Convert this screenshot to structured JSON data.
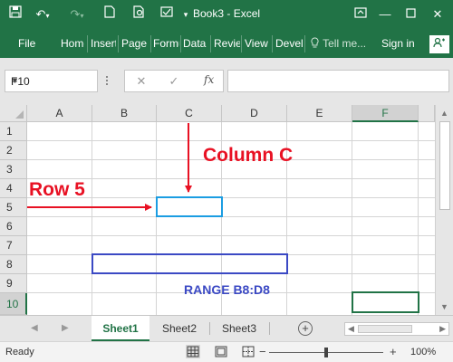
{
  "window": {
    "title": "Book3  -  Excel",
    "window_controls": [
      "restore-ribbon-icon",
      "minimize-icon",
      "maximize-icon",
      "close-icon"
    ]
  },
  "quick_access": [
    "save-icon",
    "undo-icon",
    "redo-icon",
    "new-file-icon",
    "print-preview-icon",
    "spelling-icon",
    "customize-qat-icon"
  ],
  "ribbon": {
    "tabs": [
      "File",
      "Home",
      "Insert",
      "Page Layout",
      "Formulas",
      "Data",
      "Review",
      "View",
      "Developer"
    ],
    "tell_me": "Tell me...",
    "sign_in": "Sign in",
    "share_icon": "share-icon"
  },
  "formula_bar": {
    "name_box": "F10",
    "cancel": "✕",
    "enter": "✓",
    "fx": "fx",
    "formula": ""
  },
  "grid": {
    "columns": [
      "A",
      "B",
      "C",
      "D",
      "E",
      "F"
    ],
    "rows": [
      "1",
      "2",
      "3",
      "4",
      "5",
      "6",
      "7",
      "8",
      "9",
      "10"
    ],
    "active_cell": "F10",
    "selected_column": "F",
    "selected_row": "10"
  },
  "annotations": {
    "column_label": "Column C",
    "row_label": "Row 5",
    "range_label": "RANGE B8:D8",
    "colors": {
      "arrow_red": "#e81123",
      "cell_c5_border": "#1b9de2",
      "range_border": "#3b49c4",
      "range_text": "#3b49c4",
      "active_cell_border": "#217346"
    }
  },
  "sheets": {
    "tabs": [
      "Sheet1",
      "Sheet2",
      "Sheet3"
    ],
    "active": "Sheet1"
  },
  "status_bar": {
    "status": "Ready",
    "zoom_minus": "−",
    "zoom_plus": "+",
    "zoom": "100%"
  },
  "colors": {
    "excel_green": "#217346"
  }
}
